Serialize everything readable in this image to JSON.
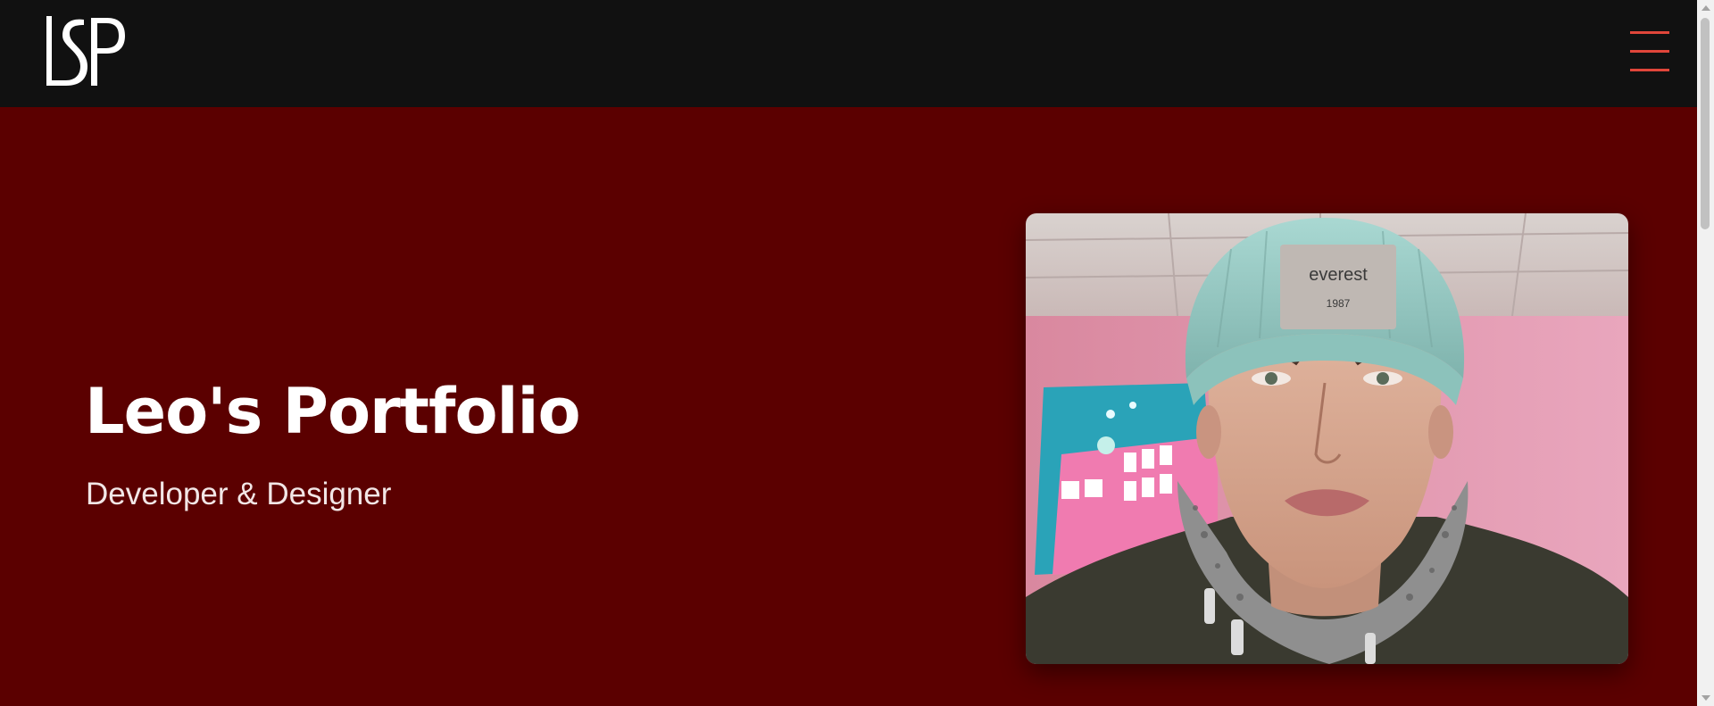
{
  "nav": {
    "logo_text": "LSP",
    "menu_icon": "hamburger-menu-icon",
    "accent_color": "#e0463a",
    "background_color": "#111111"
  },
  "hero": {
    "title": "Leo's Portfolio",
    "subtitle": "Developer & Designer",
    "background_color": "#5b0000",
    "photo": {
      "description": "selfie-portrait-photo",
      "beanie_label_text": "everest",
      "beanie_label_year": "1987"
    }
  }
}
